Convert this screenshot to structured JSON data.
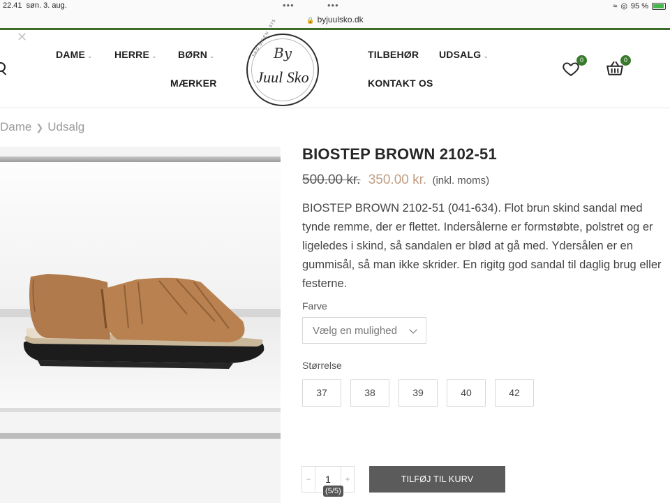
{
  "status_bar": {
    "time": "22.41",
    "date": "søn. 3. aug.",
    "url": "byjuulsko.dk",
    "battery": "95 %",
    "battery_level": 0.95,
    "dots": "•••"
  },
  "header": {
    "nav": {
      "dame": "DAME",
      "herre": "HERRE",
      "born": "BØRN",
      "maerker": "MÆRKER",
      "tilbehor": "TILBEHØR",
      "udsalg": "UDSALG",
      "kontakt": "KONTAKT OS"
    },
    "logo": {
      "by": "By",
      "name": "Juul Sko",
      "since": "SKO SIDEN 1975"
    },
    "wishlist_count": "0",
    "cart_count": "0"
  },
  "breadcrumb": {
    "items": [
      "Dame",
      "Udsalg"
    ]
  },
  "product": {
    "title": "BIOSTEP BROWN 2102-51",
    "old_price": "500.00 kr.",
    "new_price": "350.00 kr.",
    "vat_note": "(inkl. moms)",
    "description": "BIOSTEP BROWN 2102-51 (041-634). Flot brun skind sandal med tynde remme, der er flettet. Indersålerne er formstøbte, polstret og er ligeledes i skind, så sandalen er blød at gå med. Ydersålen er en gummisål, så man ikke skrider. En rigitg god sandal til daglig brug eller festerne.",
    "color_label": "Farve",
    "color_placeholder": "Vælg en mulighed",
    "size_label": "Størrelse",
    "sizes": [
      "37",
      "38",
      "39",
      "40",
      "42"
    ],
    "quantity": "1",
    "qty_minus": "−",
    "qty_plus": "+",
    "add_to_cart": "TILFØJ TIL KURV",
    "image_counter": "(5/5)"
  },
  "colors": {
    "accent_green": "#3a7a2d",
    "sale_price": "#c19e83",
    "button_gray": "#5b5b5b"
  }
}
